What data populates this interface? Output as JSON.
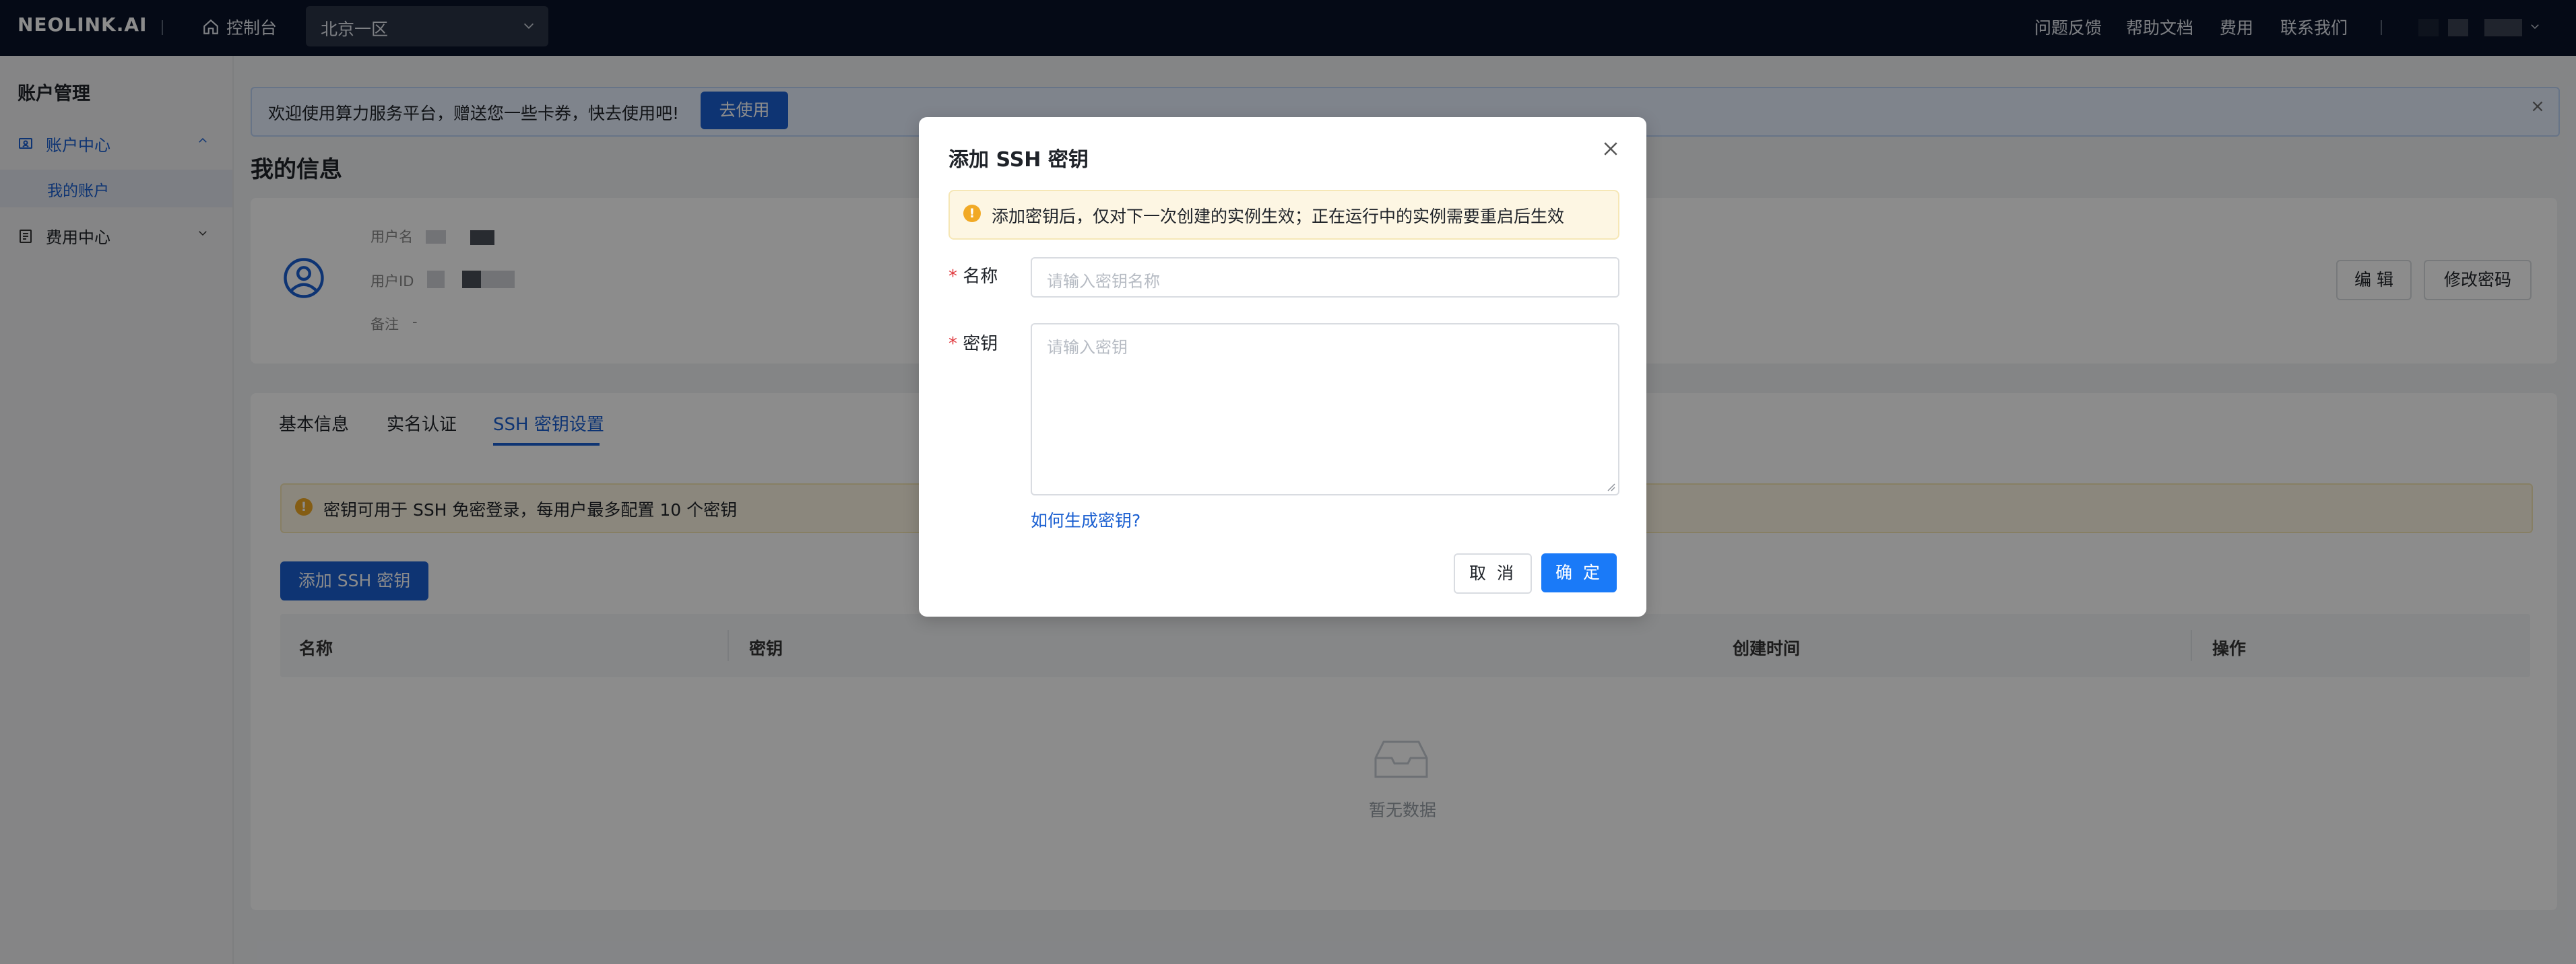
{
  "topbar": {
    "logo": "NEOLINK.AI",
    "console_label": "控制台",
    "region": "北京一区",
    "nav": [
      "问题反馈",
      "帮助文档",
      "费用",
      "联系我们"
    ]
  },
  "sidebar": {
    "title": "账户管理",
    "items": [
      {
        "label": "账户中心"
      },
      {
        "label": "我的账户"
      },
      {
        "label": "费用中心"
      }
    ]
  },
  "banner": {
    "text": "欢迎使用算力服务平台，赠送您一些卡券，快去使用吧!",
    "button": "去使用"
  },
  "profile": {
    "title": "我的信息",
    "username_label": "用户名",
    "userid_label": "用户ID",
    "remark_label": "备注",
    "remark_value": "-",
    "edit_button": "编 辑",
    "change_password_button": "修改密码"
  },
  "tabs": {
    "items": [
      "基本信息",
      "实名认证",
      "SSH 密钥设置"
    ],
    "active": "SSH 密钥设置"
  },
  "ssh": {
    "notice": "密钥可用于 SSH 免密登录，每用户最多配置 10 个密钥",
    "add_button": "添加 SSH 密钥",
    "columns": [
      "名称",
      "密钥",
      "创建时间",
      "操作"
    ],
    "empty_text": "暂无数据"
  },
  "modal": {
    "title": "添加 SSH 密钥",
    "alert": "添加密钥后，仅对下一次创建的实例生效；正在运行中的实例需要重启后生效",
    "name_label": "名称",
    "name_placeholder": "请输入密钥名称",
    "key_label": "密钥",
    "key_placeholder": "请输入密钥",
    "help_link": "如何生成密钥?",
    "cancel_button": "取 消",
    "ok_button": "确 定"
  },
  "colors": {
    "primary": "#1a5fd1",
    "topbar_bg": "#0a1328",
    "warning": "#f1a925"
  }
}
